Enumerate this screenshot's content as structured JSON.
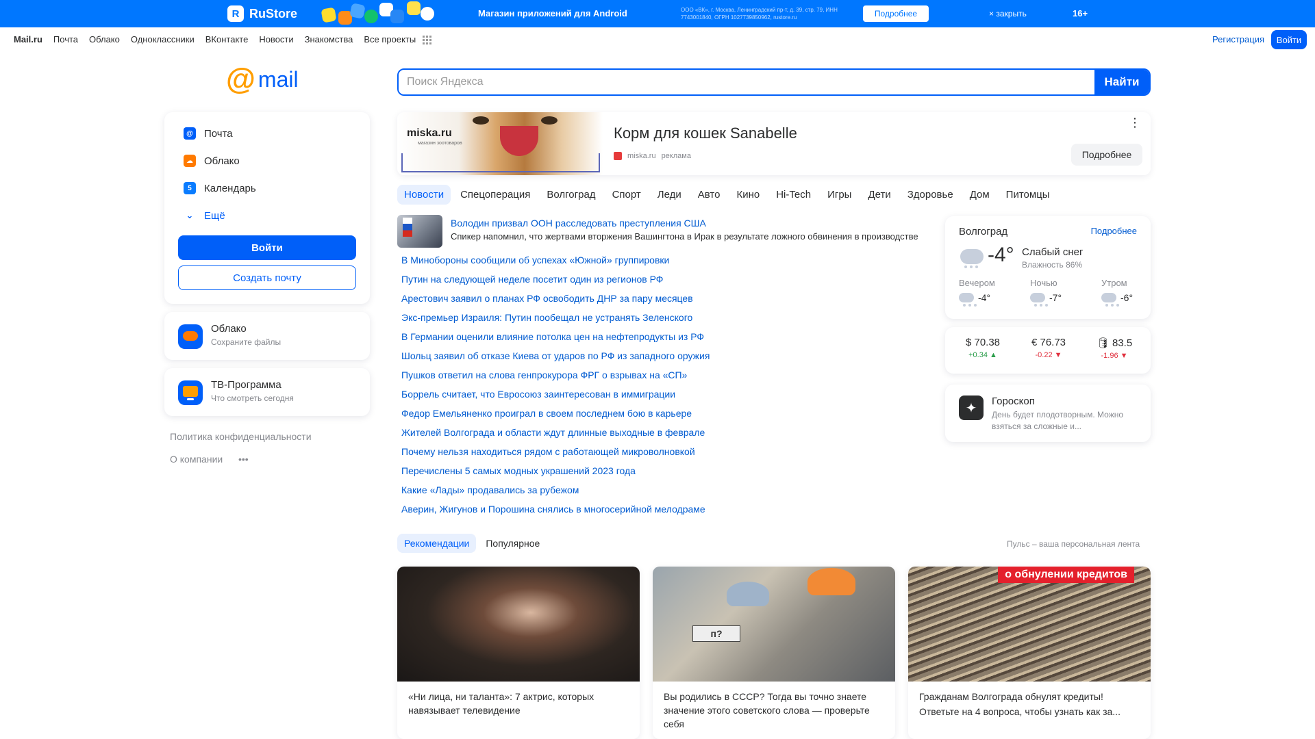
{
  "promo": {
    "brand": "RuStore",
    "tagline": "Магазин приложений для Android",
    "legal": "ООО «ВК», г. Москва, Ленинградский пр-т, д. 39, стр. 79, ИНН 7743001840, ОГРН 1027739850962, rustore.ru",
    "more_label": "Подробнее",
    "close_label": "× закрыть",
    "age": "16+"
  },
  "portal": {
    "links": [
      "Mail.ru",
      "Почта",
      "Облако",
      "Одноклассники",
      "ВКонтакте",
      "Новости",
      "Знакомства",
      "Все проекты"
    ],
    "register": "Регистрация",
    "login": "Войти"
  },
  "logo": {
    "at": "@",
    "word": "mail"
  },
  "services": {
    "items": [
      {
        "label": "Почта",
        "icon": "at-icon",
        "color": "#005ff9"
      },
      {
        "label": "Облако",
        "icon": "cloud-icon",
        "color": "#ff7a00"
      },
      {
        "label": "Календарь",
        "icon": "calendar-icon",
        "color": "#0a7cff"
      },
      {
        "label": "Ещё",
        "icon": "chevron-down-icon",
        "color": "#005ff9"
      }
    ],
    "login_button": "Войти",
    "create_button": "Создать почту"
  },
  "promos": [
    {
      "title": "Облако",
      "subtitle": "Сохраните файлы"
    },
    {
      "title": "ТВ-Программа",
      "subtitle": "Что смотреть сегодня"
    }
  ],
  "footer": {
    "privacy": "Политика конфиденциальности",
    "about": "О компании",
    "more": "•••"
  },
  "search": {
    "placeholder": "Поиск Яндекса",
    "button": "Найти"
  },
  "ad": {
    "brand": "miska.ru",
    "brand_sub": "магазин зоотоваров",
    "title": "Корм для кошек Sanabelle",
    "source": "miska.ru",
    "label": "реклама",
    "button": "Подробнее"
  },
  "news_tabs": [
    "Новости",
    "Спецоперация",
    "Волгоград",
    "Спорт",
    "Леди",
    "Авто",
    "Кино",
    "Hi-Tech",
    "Игры",
    "Дети",
    "Здоровье",
    "Дом",
    "Питомцы"
  ],
  "top_news": {
    "headline": "Володин призвал ООН расследовать преступления США",
    "description": "Спикер напомнил, что жертвами вторжения Вашингтона в Ирак в результате ложного обвинения в производстве"
  },
  "news": [
    "В Минобороны сообщили об успехах «Южной» группировки",
    "Путин на следующей неделе посетит один из регионов РФ",
    "Арестович заявил о планах РФ освободить ДНР за пару месяцев",
    "Экс-премьер Израиля: Путин пообещал не устранять Зеленского",
    "В Германии оценили влияние потолка цен на нефтепродукты из РФ",
    "Шольц заявил об отказе Киева от ударов по РФ из западного оружия",
    "Пушков ответил на слова генпрокурора ФРГ о взрывах на «СП»",
    "Боррель считает, что Евросоюз заинтересован в иммиграции",
    "Федор Емельяненко проиграл в своем последнем бою в карьере",
    "Жителей Волгограда и области ждут длинные выходные в феврале",
    "Почему нельзя находиться рядом с работающей микроволновкой",
    "Перечислены 5 самых модных украшений 2023 года",
    "Какие «Лады» продавались за рубежом",
    "Аверин, Жигунов и Порошина снялись в многосерийной мелодраме"
  ],
  "weather": {
    "city": "Волгоград",
    "more": "Подробнее",
    "temp": "-4°",
    "condition": "Слабый снег",
    "humidity": "Влажность 86%",
    "parts": [
      {
        "label": "Вечером",
        "temp": "-4°"
      },
      {
        "label": "Ночью",
        "temp": "-7°"
      },
      {
        "label": "Утром",
        "temp": "-6°"
      }
    ]
  },
  "rates": [
    {
      "symbol": "$",
      "value": "70.38",
      "change": "+0.34 ▲",
      "dir": "up"
    },
    {
      "symbol": "€",
      "value": "76.73",
      "change": "-0.22 ▼",
      "dir": "down"
    },
    {
      "symbol": "🛢",
      "value": "83.5",
      "change": "-1.96 ▼",
      "dir": "down"
    }
  ],
  "horoscope": {
    "title": "Гороскоп",
    "text": "День будет плодотворным. Можно взяться за сложные и..."
  },
  "feed": {
    "tabs": [
      "Рекомендации",
      "Популярное"
    ],
    "note": "Пульс – ваша персональная лента",
    "cards": [
      {
        "caption": "«Ни лица, ни таланта»: 7 актрис, которых навязывает телевидение",
        "sub": ""
      },
      {
        "caption": "Вы родились в СССР? Тогда вы точно знаете значение этого советского слова — проверьте себя",
        "sub": ""
      },
      {
        "caption": "Гражданам Волгограда обнулят кредиты!",
        "sub": "Ответьте на 4 вопроса, чтобы узнать как за...",
        "tag": "о обнулении кредитов"
      }
    ],
    "plate": "п?"
  }
}
